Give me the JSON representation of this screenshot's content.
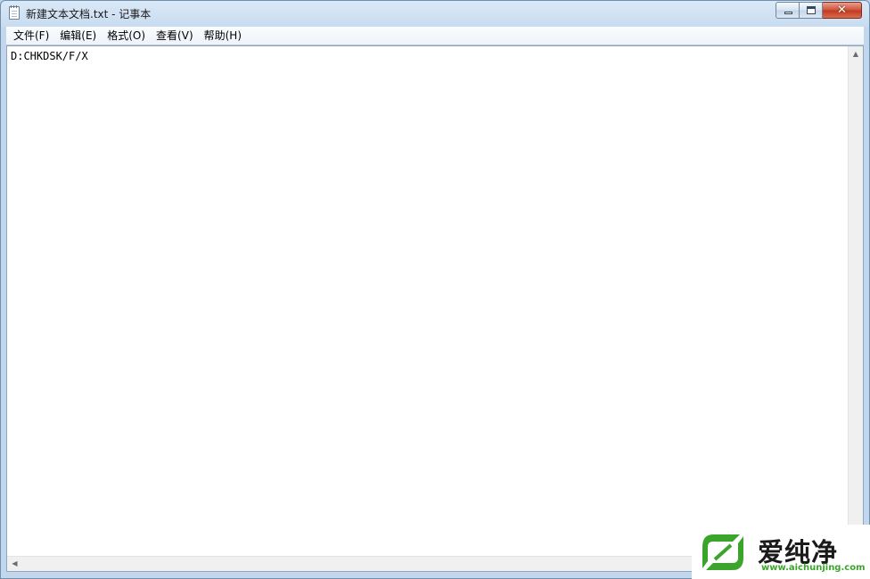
{
  "window": {
    "title": "新建文本文档.txt - 记事本"
  },
  "caption_buttons": {
    "minimize_icon": "minimize-icon",
    "maximize_icon": "maximize-icon",
    "close_icon": "close-icon",
    "close_glyph": "✕"
  },
  "menu": {
    "items": [
      {
        "label": "文件(F)"
      },
      {
        "label": "编辑(E)"
      },
      {
        "label": "格式(O)"
      },
      {
        "label": "查看(V)"
      },
      {
        "label": "帮助(H)"
      }
    ]
  },
  "editor": {
    "content": "D:CHKDSK/F/X"
  },
  "scrollbars": {
    "up_arrow": "▲",
    "left_arrow": "◀"
  },
  "watermark": {
    "text": "爱纯净",
    "url": "www.aichunjing.com",
    "color": "#3aa52a"
  }
}
